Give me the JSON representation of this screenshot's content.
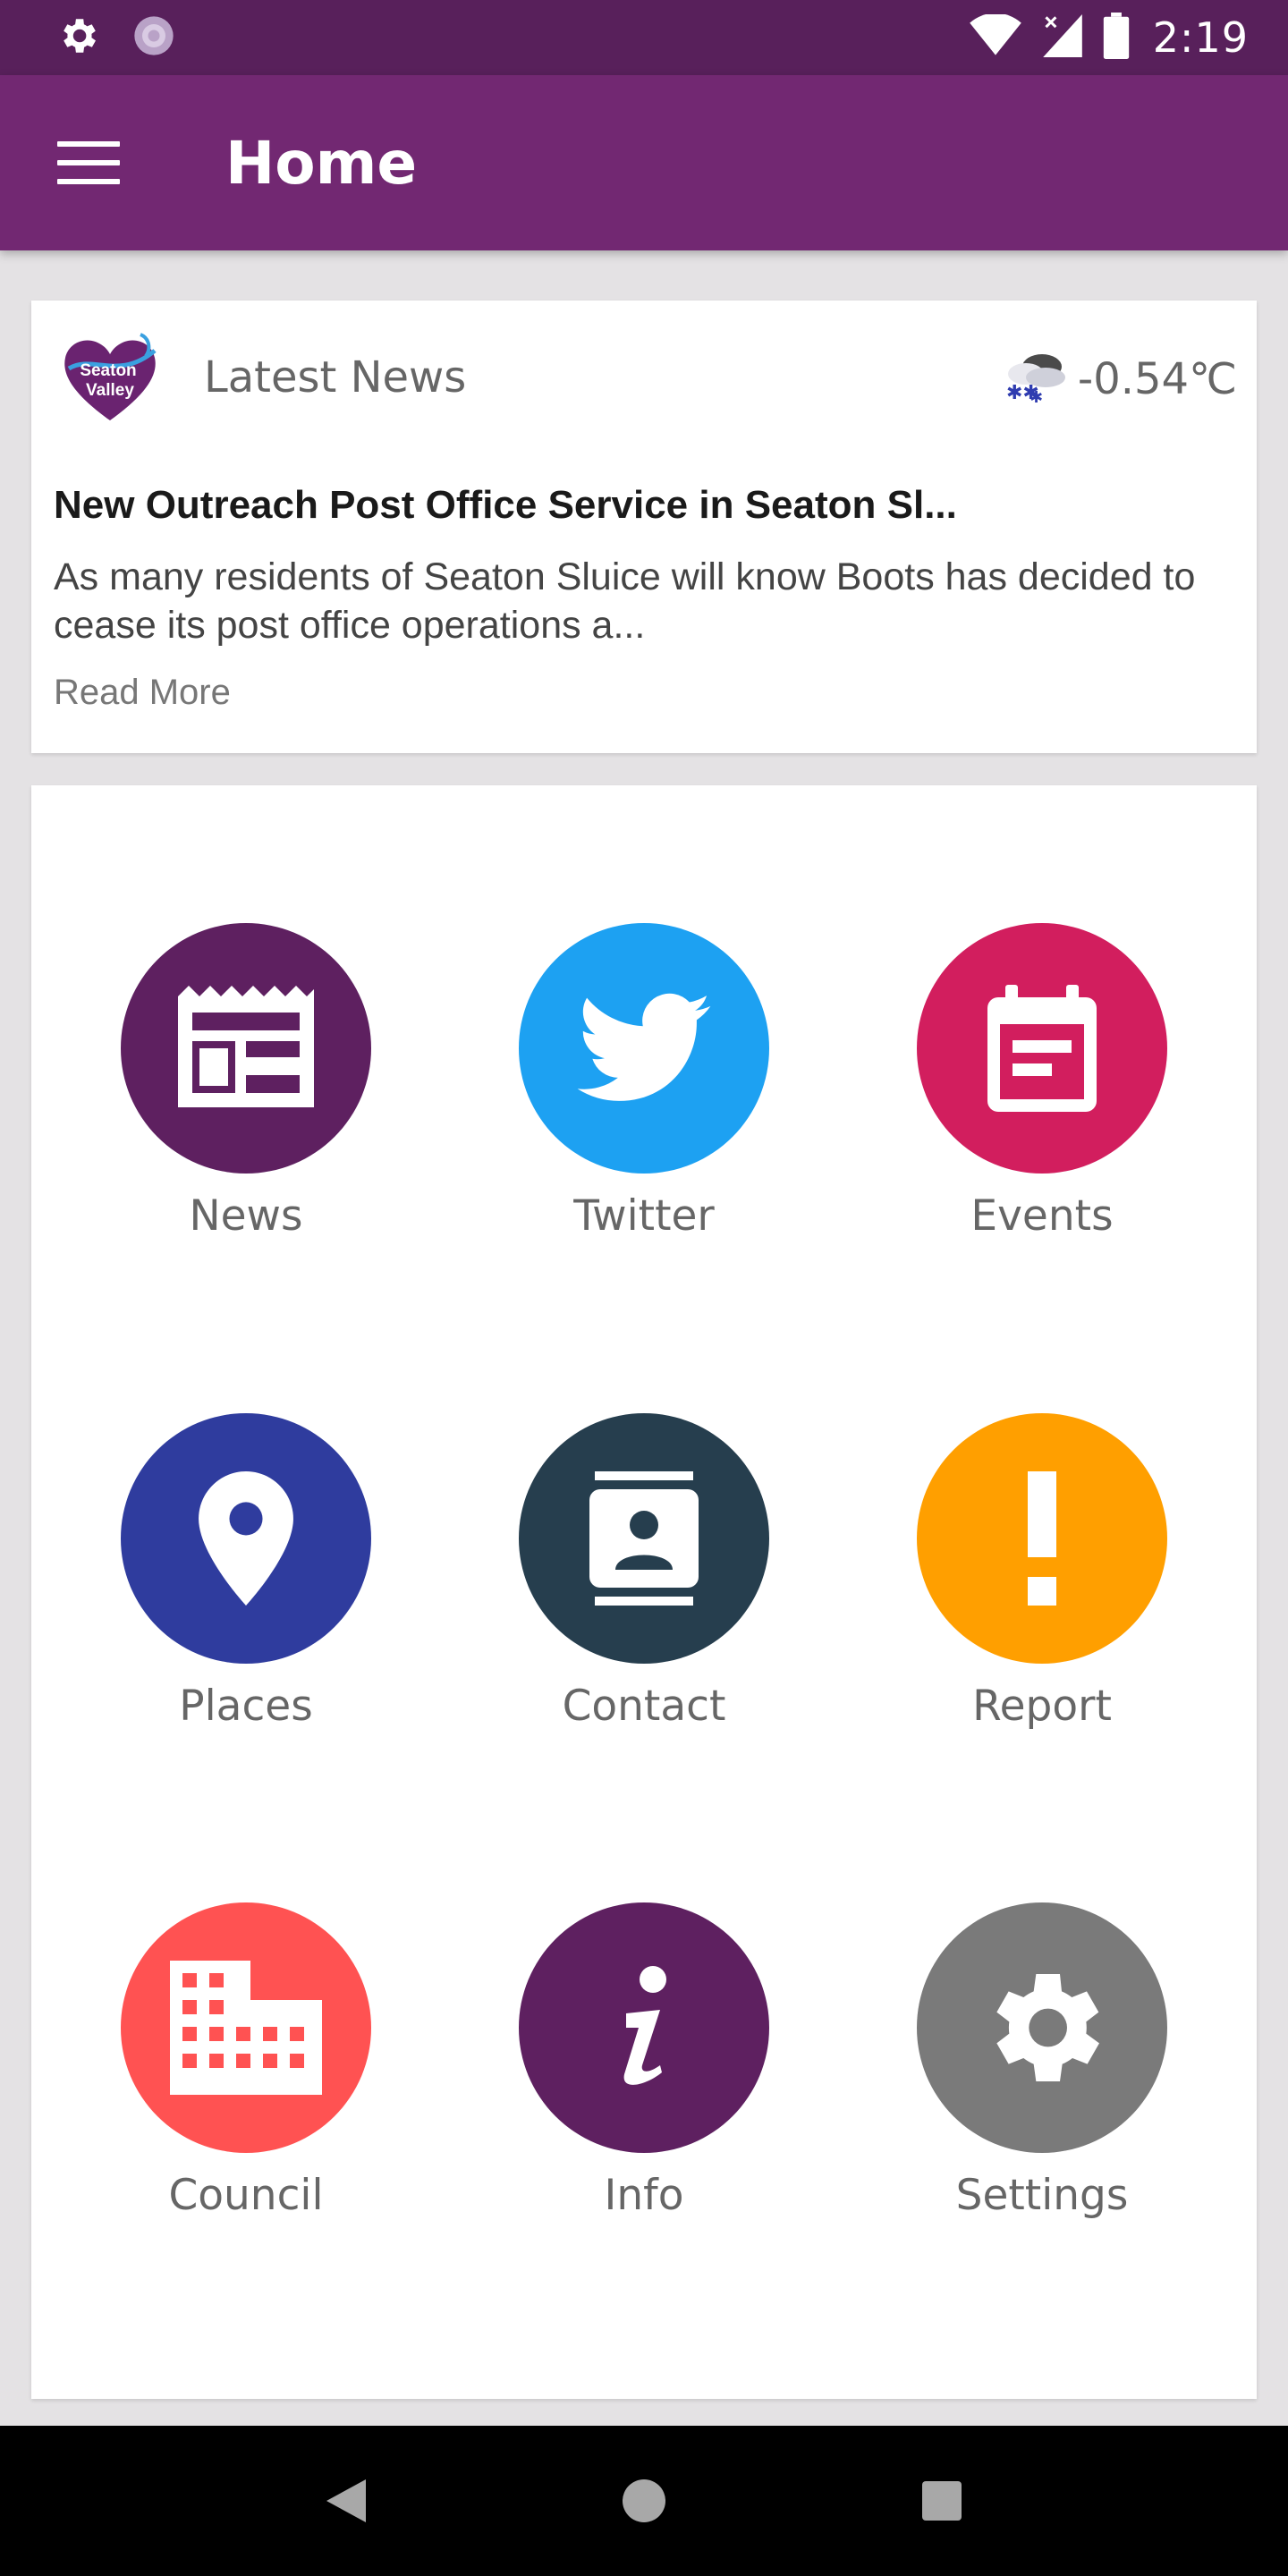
{
  "status_bar": {
    "time": "2:19",
    "left_icons": [
      "settings-gear-icon",
      "sync-spinner-icon"
    ],
    "right_icons": [
      "wifi-icon",
      "cell-signal-no-data-icon",
      "battery-icon"
    ]
  },
  "app_bar": {
    "title": "Home",
    "menu_icon": "hamburger-menu-icon",
    "color": "#722872"
  },
  "news": {
    "logo_text_1": "Seaton",
    "logo_text_2": "Valley",
    "heading": "Latest News",
    "weather_icon": "snow-cloud-icon",
    "temperature": "-0.54℃",
    "title": "New Outreach Post Office Service in Seaton Sl...",
    "excerpt": "As many residents of Seaton Sluice will know Boots has decided to cease its post office operations a...",
    "read_more": "Read More"
  },
  "tiles": [
    {
      "label": "News",
      "icon": "newspaper-icon",
      "color": "#5e2060"
    },
    {
      "label": "Twitter",
      "icon": "twitter-bird-icon",
      "color": "#1da1f2"
    },
    {
      "label": "Events",
      "icon": "calendar-icon",
      "color": "#d21e5e"
    },
    {
      "label": "Places",
      "icon": "map-pin-icon",
      "color": "#2f3c9e"
    },
    {
      "label": "Contact",
      "icon": "contact-card-icon",
      "color": "#263e4e"
    },
    {
      "label": "Report",
      "icon": "exclamation-icon",
      "color": "#ff9f00"
    },
    {
      "label": "Council",
      "icon": "building-icon",
      "color": "#ff5252"
    },
    {
      "label": "Info",
      "icon": "info-icon",
      "color": "#5e2060"
    },
    {
      "label": "Settings",
      "icon": "gear-icon",
      "color": "#7a7a7a"
    }
  ],
  "nav_bar": {
    "back_icon": "back-triangle-icon",
    "home_icon": "home-circle-icon",
    "recents_icon": "recents-square-icon"
  }
}
